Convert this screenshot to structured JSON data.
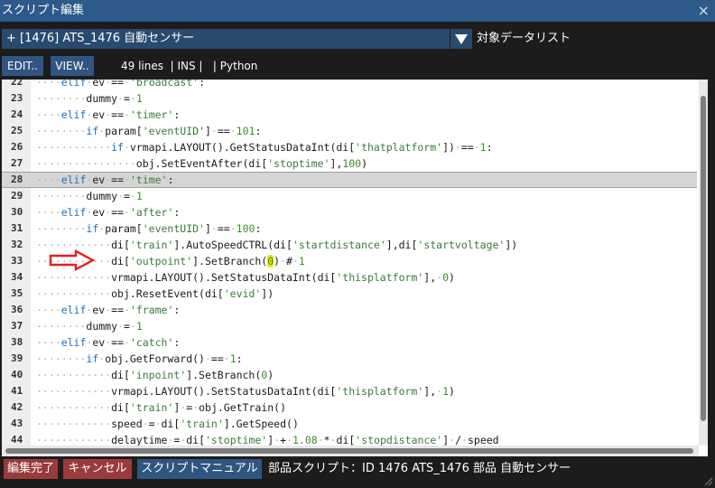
{
  "window": {
    "title": "スクリプト編集",
    "close_glyph": "×"
  },
  "selector": {
    "value": "+ [1476] ATS_1476 自動センサー",
    "target_list_label": "対象データリスト"
  },
  "toolbar": {
    "edit_label": "EDIT..",
    "view_label": "VIEW..",
    "status": "49 lines  | INS |   | Python"
  },
  "editor": {
    "highlighted_line": 28,
    "lines": [
      {
        "num": "22",
        "code": "    elif ev == 'broadcast':"
      },
      {
        "num": "23",
        "code": "        dummy = 1"
      },
      {
        "num": "24",
        "code": "    elif ev == 'timer':"
      },
      {
        "num": "25",
        "code": "        if param['eventUID'] == 101:"
      },
      {
        "num": "26",
        "code": "            if vrmapi.LAYOUT().GetStatusDataInt(di['thatplatform']) == 1:"
      },
      {
        "num": "27",
        "code": "                obj.SetEventAfter(di['stoptime'],100)"
      },
      {
        "num": "28",
        "code": "    elif ev == 'time':"
      },
      {
        "num": "29",
        "code": "        dummy = 1"
      },
      {
        "num": "30",
        "code": "    elif ev == 'after':"
      },
      {
        "num": "31",
        "code": "        if param['eventUID'] == 100:"
      },
      {
        "num": "32",
        "code": "            di['train'].AutoSpeedCTRL(di['startdistance'],di['startvoltage'])"
      },
      {
        "num": "33",
        "code": "            di['outpoint'].SetBranch(0) # 1"
      },
      {
        "num": "34",
        "code": "            vrmapi.LAYOUT().SetStatusDataInt(di['thisplatform'], 0)"
      },
      {
        "num": "35",
        "code": "            obj.ResetEvent(di['evid'])"
      },
      {
        "num": "36",
        "code": "    elif ev == 'frame':"
      },
      {
        "num": "37",
        "code": "        dummy = 1"
      },
      {
        "num": "38",
        "code": "    elif ev == 'catch':"
      },
      {
        "num": "39",
        "code": "        if obj.GetForward() == 1:"
      },
      {
        "num": "40",
        "code": "            di['inpoint'].SetBranch(0)"
      },
      {
        "num": "41",
        "code": "            vrmapi.LAYOUT().SetStatusDataInt(di['thisplatform'], 1)"
      },
      {
        "num": "42",
        "code": "            di['train'] = obj.GetTrain()"
      },
      {
        "num": "43",
        "code": "            speed = di['train'].GetSpeed()"
      },
      {
        "num": "44",
        "code": "            delaytime = di['stoptime'] + 1.08 * di['stopdistance'] / speed"
      }
    ]
  },
  "footer": {
    "done_label": "編集完了",
    "cancel_label": "キャンセル",
    "manual_label": "スクリプトマニュアル",
    "info": "部品スクリプト：ID 1476 ATS_1476 部品 自動センサー"
  },
  "colors": {
    "titlebar": "#2d5a8a",
    "button": "#2f5580",
    "danger": "#9b3a3a",
    "arrow": "#e02020",
    "highlight": "#f2e400"
  }
}
